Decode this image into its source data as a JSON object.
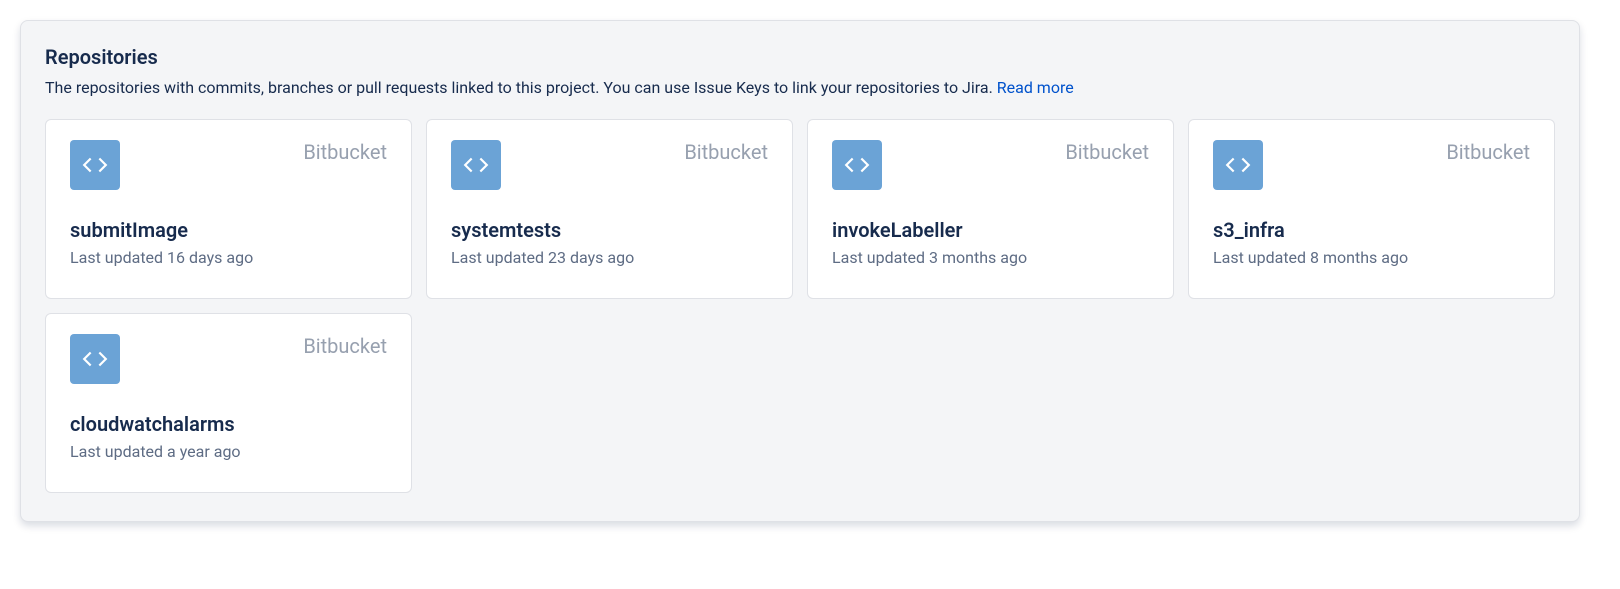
{
  "title": "Repositories",
  "description_prefix": "The repositories with commits, branches or pull requests linked to this project. You can use Issue Keys to link your repositories to Jira. ",
  "read_more": "Read more",
  "repos": [
    {
      "provider": "Bitbucket",
      "name": "submitImage",
      "updated": "Last updated 16 days ago"
    },
    {
      "provider": "Bitbucket",
      "name": "systemtests",
      "updated": "Last updated 23 days ago"
    },
    {
      "provider": "Bitbucket",
      "name": "invokeLabeller",
      "updated": "Last updated 3 months ago"
    },
    {
      "provider": "Bitbucket",
      "name": "s3_infra",
      "updated": "Last updated 8 months ago"
    },
    {
      "provider": "Bitbucket",
      "name": "cloudwatchalarms",
      "updated": "Last updated a year ago"
    }
  ]
}
